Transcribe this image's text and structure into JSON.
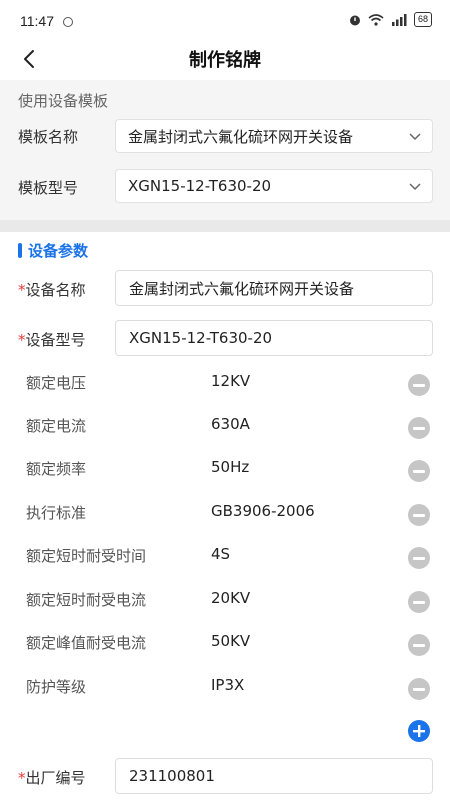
{
  "status_bar": {
    "time": "11:47",
    "battery": "68"
  },
  "nav": {
    "title": "制作铭牌"
  },
  "template": {
    "section_title": "使用设备模板",
    "name_label": "模板名称",
    "name_value": "金属封闭式六氟化硫环网开关设备",
    "model_label": "模板型号",
    "model_value": "XGN15-12-T630-20"
  },
  "params": {
    "section_title": "设备参数",
    "device_name_label": "设备名称",
    "device_name_value": "金属封闭式六氟化硫环网开关设备",
    "device_model_label": "设备型号",
    "device_model_value": "XGN15-12-T630-20",
    "items": [
      {
        "name": "额定电压",
        "value": "12KV"
      },
      {
        "name": "额定电流",
        "value": "630A"
      },
      {
        "name": "额定频率",
        "value": "50Hz"
      },
      {
        "name": "执行标准",
        "value": "GB3906-2006"
      },
      {
        "name": "额定短时耐受时间",
        "value": "4S"
      },
      {
        "name": "额定短时耐受电流",
        "value": "20KV"
      },
      {
        "name": "额定峰值耐受电流",
        "value": "50KV"
      },
      {
        "name": "防护等级",
        "value": "IP3X"
      }
    ],
    "serial_label": "出厂编号",
    "serial_value": "231100801"
  },
  "colors": {
    "accent": "#1a73e8",
    "required": "#e53935",
    "remove_icon": "#c6c6c6"
  }
}
